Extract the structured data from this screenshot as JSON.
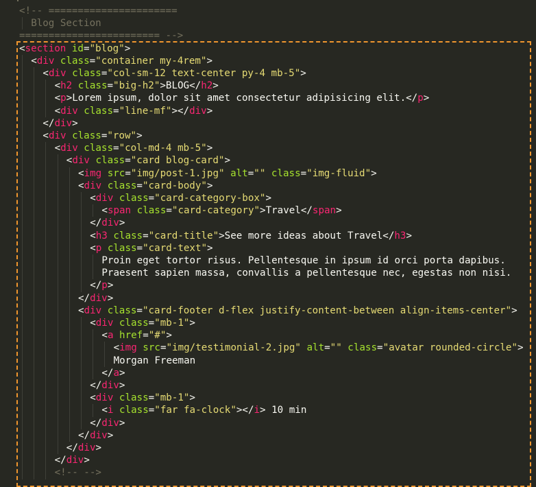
{
  "editor": {
    "theme": "monokai",
    "colors": {
      "background": "#272822",
      "comment": "#75715e",
      "tag": "#f92672",
      "attribute": "#a6e22e",
      "string": "#e6db74",
      "text": "#f8f8f2",
      "selection_border": "#f0962e"
    }
  },
  "lines": [
    {
      "indent": 0,
      "tokens": [
        {
          "t": "comment",
          "v": "<!-- ======================"
        }
      ]
    },
    {
      "indent": 2,
      "tokens": [
        {
          "t": "comment",
          "v": "Blog Section"
        }
      ]
    },
    {
      "indent": 0,
      "tokens": [
        {
          "t": "comment",
          "v": "======================== -->"
        }
      ]
    },
    {
      "indent": 0,
      "tokens": [
        {
          "t": "punc",
          "v": "<"
        },
        {
          "t": "tag",
          "v": "section"
        },
        {
          "t": "attr",
          "v": " id"
        },
        {
          "t": "punc",
          "v": "="
        },
        {
          "t": "str",
          "v": "\"blog\""
        },
        {
          "t": "punc",
          "v": ">"
        }
      ]
    },
    {
      "indent": 2,
      "tokens": [
        {
          "t": "punc",
          "v": "<"
        },
        {
          "t": "tag",
          "v": "div"
        },
        {
          "t": "attr",
          "v": " class"
        },
        {
          "t": "punc",
          "v": "="
        },
        {
          "t": "str",
          "v": "\"container my-4rem\""
        },
        {
          "t": "punc",
          "v": ">"
        }
      ]
    },
    {
      "indent": 4,
      "tokens": [
        {
          "t": "punc",
          "v": "<"
        },
        {
          "t": "tag",
          "v": "div"
        },
        {
          "t": "attr",
          "v": " class"
        },
        {
          "t": "punc",
          "v": "="
        },
        {
          "t": "str",
          "v": "\"col-sm-12 text-center py-4 mb-5\""
        },
        {
          "t": "punc",
          "v": ">"
        }
      ]
    },
    {
      "indent": 6,
      "tokens": [
        {
          "t": "punc",
          "v": "<"
        },
        {
          "t": "tag",
          "v": "h2"
        },
        {
          "t": "attr",
          "v": " class"
        },
        {
          "t": "punc",
          "v": "="
        },
        {
          "t": "str",
          "v": "\"big-h2\""
        },
        {
          "t": "punc",
          "v": ">"
        },
        {
          "t": "text",
          "v": "BLOG"
        },
        {
          "t": "punc",
          "v": "</"
        },
        {
          "t": "tag",
          "v": "h2"
        },
        {
          "t": "punc",
          "v": ">"
        }
      ]
    },
    {
      "indent": 6,
      "tokens": [
        {
          "t": "punc",
          "v": "<"
        },
        {
          "t": "tag",
          "v": "p"
        },
        {
          "t": "punc",
          "v": ">"
        },
        {
          "t": "text",
          "v": "Lorem ipsum, dolor sit amet consectetur adipisicing elit."
        },
        {
          "t": "punc",
          "v": "</"
        },
        {
          "t": "tag",
          "v": "p"
        },
        {
          "t": "punc",
          "v": ">"
        }
      ]
    },
    {
      "indent": 6,
      "tokens": [
        {
          "t": "punc",
          "v": "<"
        },
        {
          "t": "tag",
          "v": "div"
        },
        {
          "t": "attr",
          "v": " class"
        },
        {
          "t": "punc",
          "v": "="
        },
        {
          "t": "str",
          "v": "\"line-mf\""
        },
        {
          "t": "punc",
          "v": "></"
        },
        {
          "t": "tag",
          "v": "div"
        },
        {
          "t": "punc",
          "v": ">"
        }
      ]
    },
    {
      "indent": 4,
      "tokens": [
        {
          "t": "punc",
          "v": "</"
        },
        {
          "t": "tag",
          "v": "div"
        },
        {
          "t": "punc",
          "v": ">"
        }
      ]
    },
    {
      "indent": 4,
      "tokens": [
        {
          "t": "punc",
          "v": "<"
        },
        {
          "t": "tag",
          "v": "div"
        },
        {
          "t": "attr",
          "v": " class"
        },
        {
          "t": "punc",
          "v": "="
        },
        {
          "t": "str",
          "v": "\"row\""
        },
        {
          "t": "punc",
          "v": ">"
        }
      ]
    },
    {
      "indent": 6,
      "tokens": [
        {
          "t": "punc",
          "v": "<"
        },
        {
          "t": "tag",
          "v": "div"
        },
        {
          "t": "attr",
          "v": " class"
        },
        {
          "t": "punc",
          "v": "="
        },
        {
          "t": "str",
          "v": "\"col-md-4 mb-5\""
        },
        {
          "t": "punc",
          "v": ">"
        }
      ]
    },
    {
      "indent": 8,
      "tokens": [
        {
          "t": "punc",
          "v": "<"
        },
        {
          "t": "tag",
          "v": "div"
        },
        {
          "t": "attr",
          "v": " class"
        },
        {
          "t": "punc",
          "v": "="
        },
        {
          "t": "str",
          "v": "\"card blog-card\""
        },
        {
          "t": "punc",
          "v": ">"
        }
      ]
    },
    {
      "indent": 10,
      "tokens": [
        {
          "t": "punc",
          "v": "<"
        },
        {
          "t": "tag",
          "v": "img"
        },
        {
          "t": "attr",
          "v": " src"
        },
        {
          "t": "punc",
          "v": "="
        },
        {
          "t": "str",
          "v": "\"img/post-1.jpg\""
        },
        {
          "t": "attr",
          "v": " alt"
        },
        {
          "t": "punc",
          "v": "="
        },
        {
          "t": "str",
          "v": "\"\""
        },
        {
          "t": "attr",
          "v": " class"
        },
        {
          "t": "punc",
          "v": "="
        },
        {
          "t": "str",
          "v": "\"img-fluid\""
        },
        {
          "t": "punc",
          "v": ">"
        }
      ]
    },
    {
      "indent": 10,
      "tokens": [
        {
          "t": "punc",
          "v": "<"
        },
        {
          "t": "tag",
          "v": "div"
        },
        {
          "t": "attr",
          "v": " class"
        },
        {
          "t": "punc",
          "v": "="
        },
        {
          "t": "str",
          "v": "\"card-body\""
        },
        {
          "t": "punc",
          "v": ">"
        }
      ]
    },
    {
      "indent": 12,
      "tokens": [
        {
          "t": "punc",
          "v": "<"
        },
        {
          "t": "tag",
          "v": "div"
        },
        {
          "t": "attr",
          "v": " class"
        },
        {
          "t": "punc",
          "v": "="
        },
        {
          "t": "str",
          "v": "\"card-category-box\""
        },
        {
          "t": "punc",
          "v": ">"
        }
      ]
    },
    {
      "indent": 14,
      "tokens": [
        {
          "t": "punc",
          "v": "<"
        },
        {
          "t": "tag",
          "v": "span"
        },
        {
          "t": "attr",
          "v": " class"
        },
        {
          "t": "punc",
          "v": "="
        },
        {
          "t": "str",
          "v": "\"card-category\""
        },
        {
          "t": "punc",
          "v": ">"
        },
        {
          "t": "text",
          "v": "Travel"
        },
        {
          "t": "punc",
          "v": "</"
        },
        {
          "t": "tag",
          "v": "span"
        },
        {
          "t": "punc",
          "v": ">"
        }
      ]
    },
    {
      "indent": 12,
      "tokens": [
        {
          "t": "punc",
          "v": "</"
        },
        {
          "t": "tag",
          "v": "div"
        },
        {
          "t": "punc",
          "v": ">"
        }
      ]
    },
    {
      "indent": 12,
      "tokens": [
        {
          "t": "punc",
          "v": "<"
        },
        {
          "t": "tag",
          "v": "h3"
        },
        {
          "t": "attr",
          "v": " class"
        },
        {
          "t": "punc",
          "v": "="
        },
        {
          "t": "str",
          "v": "\"card-title\""
        },
        {
          "t": "punc",
          "v": ">"
        },
        {
          "t": "text",
          "v": "See more ideas about Travel"
        },
        {
          "t": "punc",
          "v": "</"
        },
        {
          "t": "tag",
          "v": "h3"
        },
        {
          "t": "punc",
          "v": ">"
        }
      ]
    },
    {
      "indent": 12,
      "tokens": [
        {
          "t": "punc",
          "v": "<"
        },
        {
          "t": "tag",
          "v": "p"
        },
        {
          "t": "attr",
          "v": " class"
        },
        {
          "t": "punc",
          "v": "="
        },
        {
          "t": "str",
          "v": "\"card-text\""
        },
        {
          "t": "punc",
          "v": ">"
        }
      ]
    },
    {
      "indent": 14,
      "tokens": [
        {
          "t": "text",
          "v": "Proin eget tortor risus. Pellentesque in ipsum id orci porta dapibus."
        }
      ]
    },
    {
      "indent": 14,
      "tokens": [
        {
          "t": "text",
          "v": "Praesent sapien massa, convallis a pellentesque nec, egestas non nisi."
        }
      ]
    },
    {
      "indent": 12,
      "tokens": [
        {
          "t": "punc",
          "v": "</"
        },
        {
          "t": "tag",
          "v": "p"
        },
        {
          "t": "punc",
          "v": ">"
        }
      ]
    },
    {
      "indent": 10,
      "tokens": [
        {
          "t": "punc",
          "v": "</"
        },
        {
          "t": "tag",
          "v": "div"
        },
        {
          "t": "punc",
          "v": ">"
        }
      ]
    },
    {
      "indent": 10,
      "tokens": [
        {
          "t": "punc",
          "v": "<"
        },
        {
          "t": "tag",
          "v": "div"
        },
        {
          "t": "attr",
          "v": " class"
        },
        {
          "t": "punc",
          "v": "="
        },
        {
          "t": "str",
          "v": "\"card-footer d-flex justify-content-between align-items-center\""
        },
        {
          "t": "punc",
          "v": ">"
        }
      ]
    },
    {
      "indent": 12,
      "tokens": [
        {
          "t": "punc",
          "v": "<"
        },
        {
          "t": "tag",
          "v": "div"
        },
        {
          "t": "attr",
          "v": " class"
        },
        {
          "t": "punc",
          "v": "="
        },
        {
          "t": "str",
          "v": "\"mb-1\""
        },
        {
          "t": "punc",
          "v": ">"
        }
      ]
    },
    {
      "indent": 14,
      "tokens": [
        {
          "t": "punc",
          "v": "<"
        },
        {
          "t": "tag",
          "v": "a"
        },
        {
          "t": "attr",
          "v": " href"
        },
        {
          "t": "punc",
          "v": "="
        },
        {
          "t": "str",
          "v": "\"#\""
        },
        {
          "t": "punc",
          "v": ">"
        }
      ]
    },
    {
      "indent": 16,
      "tokens": [
        {
          "t": "punc",
          "v": "<"
        },
        {
          "t": "tag",
          "v": "img"
        },
        {
          "t": "attr",
          "v": " src"
        },
        {
          "t": "punc",
          "v": "="
        },
        {
          "t": "str",
          "v": "\"img/testimonial-2.jpg\""
        },
        {
          "t": "attr",
          "v": " alt"
        },
        {
          "t": "punc",
          "v": "="
        },
        {
          "t": "str",
          "v": "\"\""
        },
        {
          "t": "attr",
          "v": " class"
        },
        {
          "t": "punc",
          "v": "="
        },
        {
          "t": "str",
          "v": "\"avatar rounded-circle\""
        },
        {
          "t": "punc",
          "v": ">"
        }
      ]
    },
    {
      "indent": 16,
      "tokens": [
        {
          "t": "text",
          "v": "Morgan Freeman"
        }
      ]
    },
    {
      "indent": 14,
      "tokens": [
        {
          "t": "punc",
          "v": "</"
        },
        {
          "t": "tag",
          "v": "a"
        },
        {
          "t": "punc",
          "v": ">"
        }
      ]
    },
    {
      "indent": 12,
      "tokens": [
        {
          "t": "punc",
          "v": "</"
        },
        {
          "t": "tag",
          "v": "div"
        },
        {
          "t": "punc",
          "v": ">"
        }
      ]
    },
    {
      "indent": 12,
      "tokens": [
        {
          "t": "punc",
          "v": "<"
        },
        {
          "t": "tag",
          "v": "div"
        },
        {
          "t": "attr",
          "v": " class"
        },
        {
          "t": "punc",
          "v": "="
        },
        {
          "t": "str",
          "v": "\"mb-1\""
        },
        {
          "t": "punc",
          "v": ">"
        }
      ]
    },
    {
      "indent": 14,
      "tokens": [
        {
          "t": "punc",
          "v": "<"
        },
        {
          "t": "tag",
          "v": "i"
        },
        {
          "t": "attr",
          "v": " class"
        },
        {
          "t": "punc",
          "v": "="
        },
        {
          "t": "str",
          "v": "\"far fa-clock\""
        },
        {
          "t": "punc",
          "v": "></"
        },
        {
          "t": "tag",
          "v": "i"
        },
        {
          "t": "punc",
          "v": ">"
        },
        {
          "t": "text",
          "v": " 10 min"
        }
      ]
    },
    {
      "indent": 12,
      "tokens": [
        {
          "t": "punc",
          "v": "</"
        },
        {
          "t": "tag",
          "v": "div"
        },
        {
          "t": "punc",
          "v": ">"
        }
      ]
    },
    {
      "indent": 10,
      "tokens": [
        {
          "t": "punc",
          "v": "</"
        },
        {
          "t": "tag",
          "v": "div"
        },
        {
          "t": "punc",
          "v": ">"
        }
      ]
    },
    {
      "indent": 8,
      "tokens": [
        {
          "t": "punc",
          "v": "</"
        },
        {
          "t": "tag",
          "v": "div"
        },
        {
          "t": "punc",
          "v": ">"
        }
      ]
    },
    {
      "indent": 6,
      "tokens": [
        {
          "t": "punc",
          "v": "</"
        },
        {
          "t": "tag",
          "v": "div"
        },
        {
          "t": "punc",
          "v": ">"
        }
      ]
    },
    {
      "indent": 6,
      "tokens": [
        {
          "t": "comment",
          "v": "<!-- -->"
        }
      ]
    }
  ]
}
